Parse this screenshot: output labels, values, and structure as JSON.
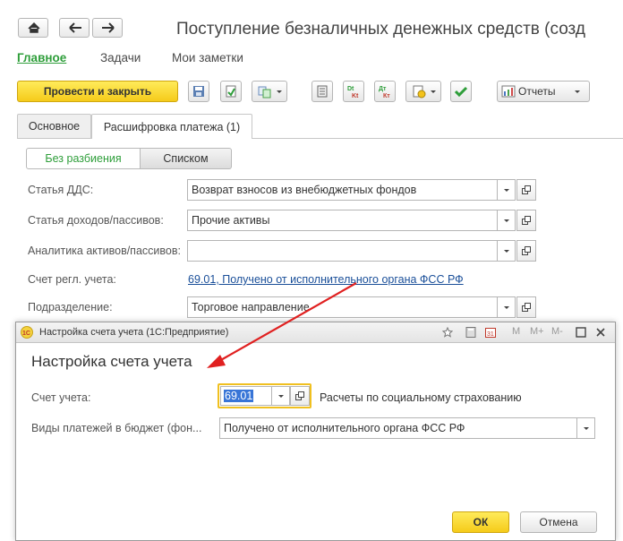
{
  "nav": {
    "home_icon": "home-icon",
    "back_icon": "arrow-left-icon",
    "forward_icon": "arrow-right-icon"
  },
  "window": {
    "title": "Поступление безналичных денежных средств (созд"
  },
  "sections": [
    "Главное",
    "Задачи",
    "Мои заметки"
  ],
  "toolbar": {
    "post_close": "Провести и закрыть",
    "reports": "Отчеты",
    "icons": [
      "save-icon",
      "post-icon",
      "related-docs-icon",
      "ledger-icon",
      "dt-ct-icon",
      "dt-ct-red-icon",
      "print-icon",
      "check-icon",
      "reports-icon"
    ],
    "dt_glyph": "Dt",
    "kt_glyph": "Kt",
    "dt_ru_glyph": "Дт",
    "kt_ru_glyph": "Кт"
  },
  "tabs": [
    "Основное",
    "Расшифровка платежа (1)"
  ],
  "segments": [
    "Без разбиения",
    "Списком"
  ],
  "form": {
    "dds_label": "Статья ДДС:",
    "dds_value": "Возврат взносов из внебюджетных фондов",
    "income_label": "Статья доходов/пассивов:",
    "income_value": "Прочие активы",
    "analytics_label": "Аналитика активов/пассивов:",
    "analytics_value": "",
    "account_label": "Счет регл. учета:",
    "account_link": "69.01, Получено от исполнительного органа ФСС РФ",
    "division_label": "Подразделение:",
    "division_value": "Торговое направление"
  },
  "dialog": {
    "window_title": "Настройка счета учета  (1С:Предприятие)",
    "heading": "Настройка счета учета",
    "account_label": "Счет учета:",
    "account_value": "69.01",
    "account_desc": "Расчеты по социальному страхованию",
    "payments_label": "Виды платежей в бюджет (фон...",
    "payments_value": "Получено от исполнительного органа ФСС РФ",
    "ok": "ОК",
    "cancel": "Отмена",
    "title_controls": [
      "M",
      "M+",
      "M-"
    ],
    "logo_text": "1С",
    "calendar_glyph": "31"
  },
  "colors": {
    "accent_green": "#2e9e3a",
    "primary_yellow": "#f5cb1a",
    "link_blue": "#1a4f99",
    "arrow_red": "#e02020"
  }
}
